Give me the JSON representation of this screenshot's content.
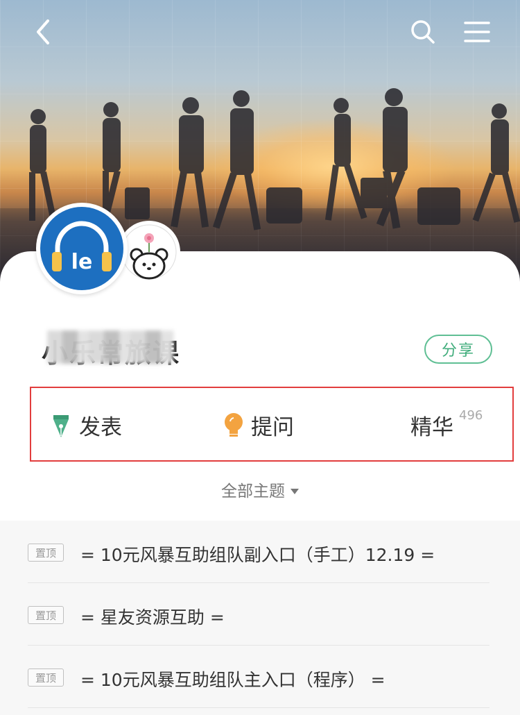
{
  "group": {
    "title": "小乐常旅课",
    "share_label": "分享"
  },
  "actions": [
    {
      "label": "发表",
      "icon": "pen-nib-icon"
    },
    {
      "label": "提问",
      "icon": "lightbulb-icon"
    },
    {
      "label": "精华",
      "count": "496"
    }
  ],
  "filter": {
    "label": "全部主题"
  },
  "topics": [
    {
      "tag": "置顶",
      "text": "= 10元风暴互助组队副入口（手工）12.19 ="
    },
    {
      "tag": "置顶",
      "text": "= 星友资源互助 ="
    },
    {
      "tag": "置顶",
      "text": "= 10元风暴互助组队主入口（程序） ="
    }
  ],
  "avatar": {
    "logo_text": "le"
  },
  "colors": {
    "accent_green": "#41ad7c",
    "highlight_red": "#e23d3d",
    "logo_blue": "#1d6fc0",
    "bulb_orange": "#f3a340"
  }
}
